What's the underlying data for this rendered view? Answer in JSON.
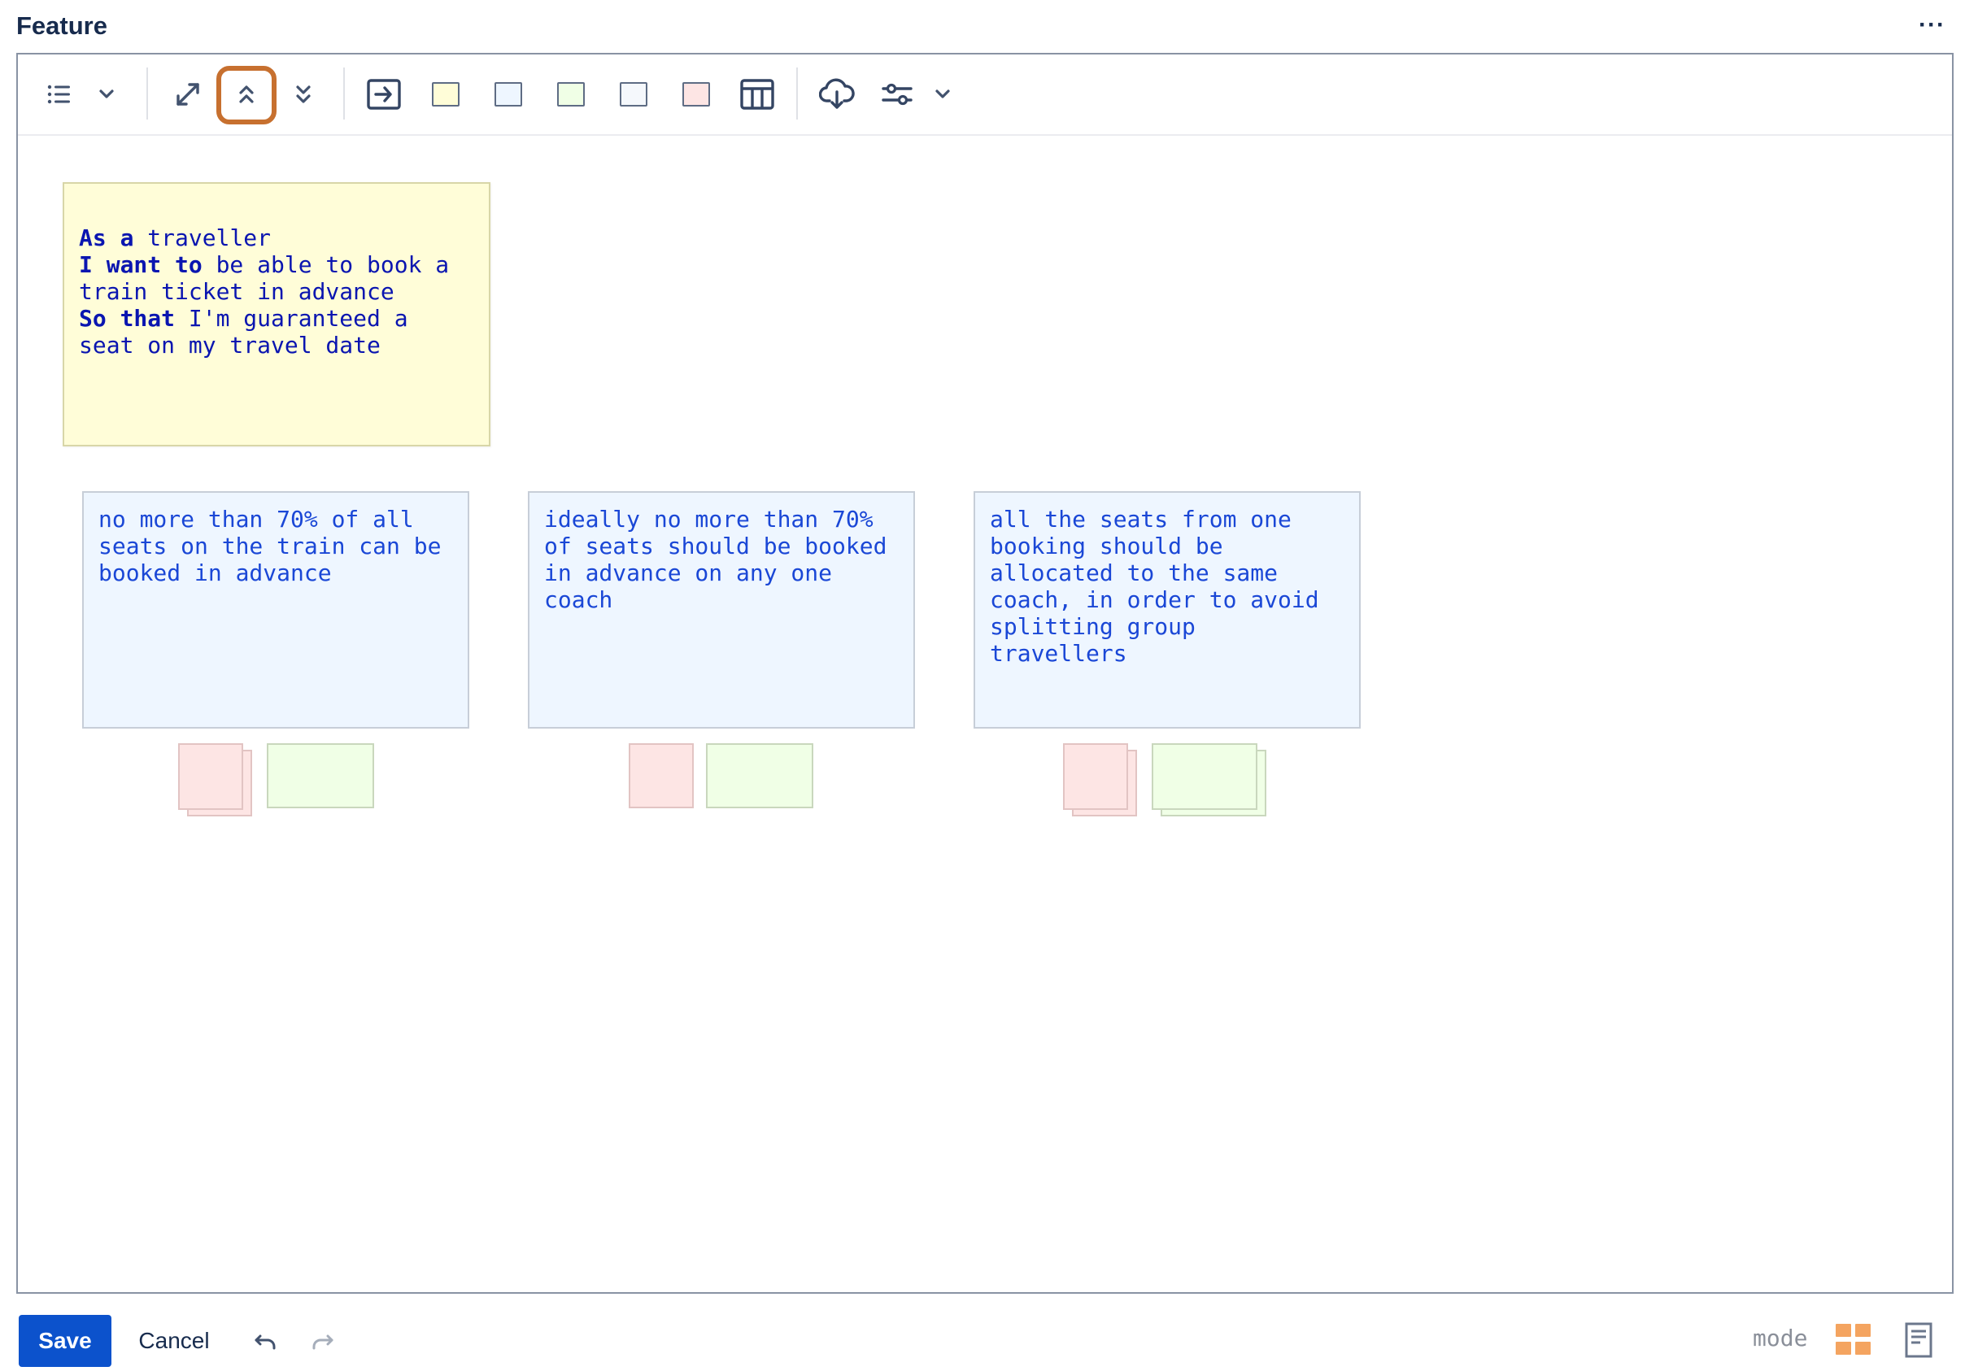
{
  "header": {
    "title": "Feature",
    "more_label": "···"
  },
  "toolbar": {
    "icons": [
      "list-icon",
      "chevron-down-icon",
      "expand-icon",
      "collapse-up-icon",
      "expand-down-icon",
      "insert-card-icon",
      "yellow-card-swatch",
      "blue-card-swatch",
      "green-card-swatch",
      "white-card-swatch",
      "red-card-swatch",
      "table-icon",
      "cloud-download-icon",
      "settings-sliders-icon",
      "chevron-down-icon"
    ],
    "highlighted": "collapse-up-icon"
  },
  "story": {
    "line1_kw": "As a",
    "line1_rest": " traveller",
    "line2_kw": "I want to",
    "line2_rest": " be able to book a\ntrain ticket in advance",
    "line3_kw": "So that",
    "line3_rest": " I'm guaranteed a\nseat on my travel date"
  },
  "rules": [
    {
      "text": "no more than 70% of all\nseats on the train can be\nbooked in advance"
    },
    {
      "text": "ideally no more than 70%\nof seats should be booked\nin advance on any one\ncoach"
    },
    {
      "text": "all the seats from one\nbooking should be\nallocated to the same\ncoach, in order to avoid\nsplitting group\ntravellers"
    }
  ],
  "colors": {
    "story_bg": "#fffdd8",
    "rule_bg": "#eef6ff",
    "question_bg": "#fde5e4",
    "example_bg": "#f0ffe6",
    "primary": "#0c52cc",
    "highlight": "#c7702f",
    "mode_icon": "#f4a460"
  },
  "footer": {
    "save_label": "Save",
    "cancel_label": "Cancel",
    "mode_label": "mode"
  }
}
